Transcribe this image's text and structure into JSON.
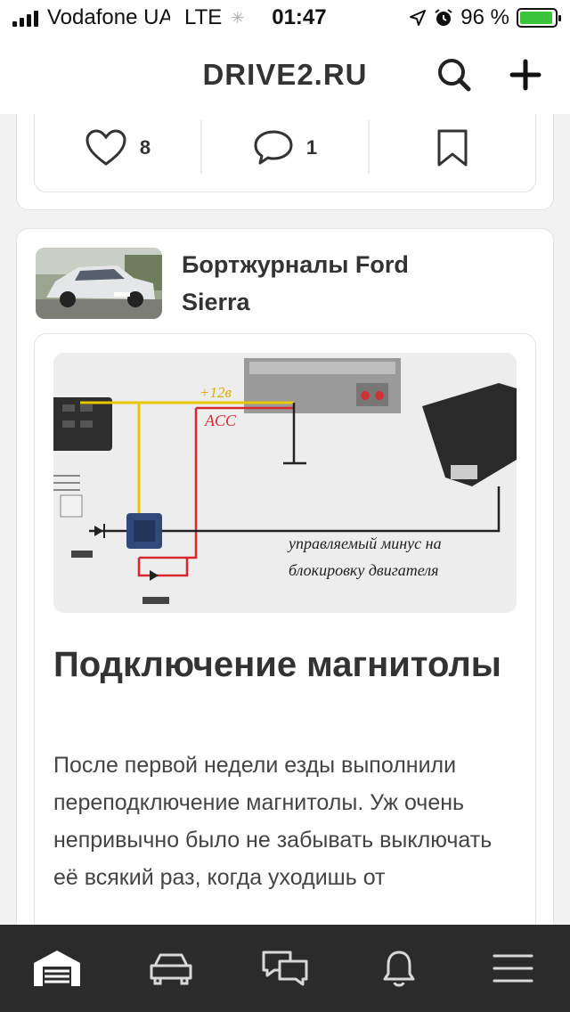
{
  "status_bar": {
    "carrier": "Vodafone UA",
    "network": "LTE",
    "time": "01:47",
    "battery_text": "96 %",
    "battery_level": 0.96
  },
  "header": {
    "title": "DRIVE2.RU",
    "search_icon": "search-icon",
    "add_icon": "plus-icon"
  },
  "prev_card": {
    "likes": "8",
    "comments": "1"
  },
  "post": {
    "source_title": "Бортжурналы Ford Sierra",
    "diagram_labels": {
      "plus12": "+12в",
      "acc": "ACC",
      "caption_line1": "управляемый минус на",
      "caption_line2": "блокировку двигателя"
    },
    "title": "Подключение магнитолы",
    "body": "После первой недели езды выполнили переподключение магнитолы. Уж очень непривычно было не забывать выключать её всякий раз, когда уходишь от"
  },
  "tabbar": {
    "items": [
      "garage-icon",
      "car-icon",
      "messages-icon",
      "bell-icon",
      "menu-icon"
    ]
  },
  "colors": {
    "accent_green": "#3dc43d",
    "tabbar_bg": "#2b2b2b",
    "wire_yellow": "#e8c800",
    "wire_red": "#d9272e"
  }
}
